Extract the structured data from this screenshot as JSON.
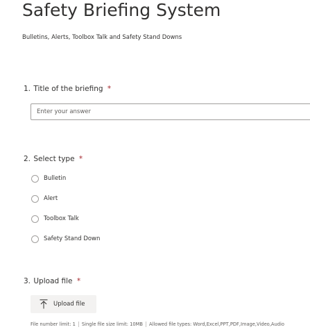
{
  "form": {
    "title": "Safety Briefing System",
    "description": "Bulletins, Alerts, Toolbox Talk and Safety Stand Downs"
  },
  "questions": [
    {
      "number": "1.",
      "title": "Title of the briefing",
      "required_mark": "*",
      "placeholder": "Enter your answer"
    },
    {
      "number": "2.",
      "title": "Select type",
      "required_mark": "*",
      "options": [
        "Bulletin",
        "Alert",
        "Toolbox Talk",
        "Safety Stand Down"
      ]
    },
    {
      "number": "3.",
      "title": "Upload file",
      "required_mark": "*",
      "upload_label": "Upload file",
      "upload_icon": "upload-icon",
      "limits": [
        "File number limit: 1",
        "Single file size limit: 10MB",
        "Allowed file types: Word,Excel,PPT,PDF,Image,Video,Audio"
      ]
    }
  ],
  "colors": {
    "required": "#a4262c",
    "text": "#323130",
    "muted": "#605e5c",
    "border": "#a19f9d",
    "button_bg": "#f3f2f1"
  }
}
